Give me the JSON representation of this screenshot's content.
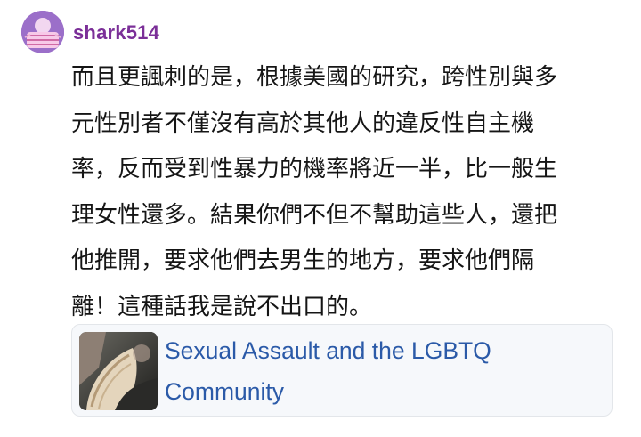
{
  "author": {
    "username": "shark514",
    "avatar_icon": "masked-face-avatar-icon",
    "avatar_color": "#9b6fc9",
    "username_color": "#7b2f98"
  },
  "post": {
    "lines": [
      "而且更諷刺的是，根據美國的研究，跨性別與多",
      "元性別者不僅沒有高於其他人的違反性自主機",
      "率，反而受到性暴力的機率將近一半，比一般生",
      "理女性還多。結果你們不但不幫助這些人，還把",
      "他推開，要求他們去男生的地方，要求他們隔",
      "離！這種話我是說不出口的。"
    ]
  },
  "link_preview": {
    "title_lines": [
      "Sexual Assault and the LGBTQ",
      "Community"
    ],
    "thumbnail_icon": "fur-hood-photo-thumbnail",
    "title_color": "#2b5aa8"
  }
}
